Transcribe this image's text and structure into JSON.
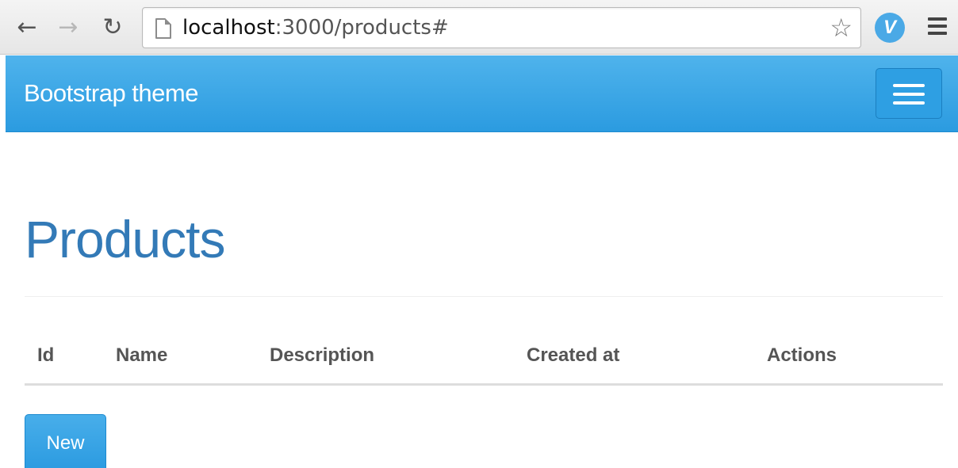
{
  "browser": {
    "url_host": "localhost",
    "url_rest": ":3000/products#"
  },
  "navbar": {
    "brand": "Bootstrap theme"
  },
  "page": {
    "title": "Products"
  },
  "table": {
    "columns": [
      "Id",
      "Name",
      "Description",
      "Created at",
      "Actions"
    ]
  },
  "actions": {
    "new_label": "New"
  },
  "colors": {
    "navbar": "#2b9be0",
    "title": "#337ab7",
    "button": "#2a9ae0"
  }
}
